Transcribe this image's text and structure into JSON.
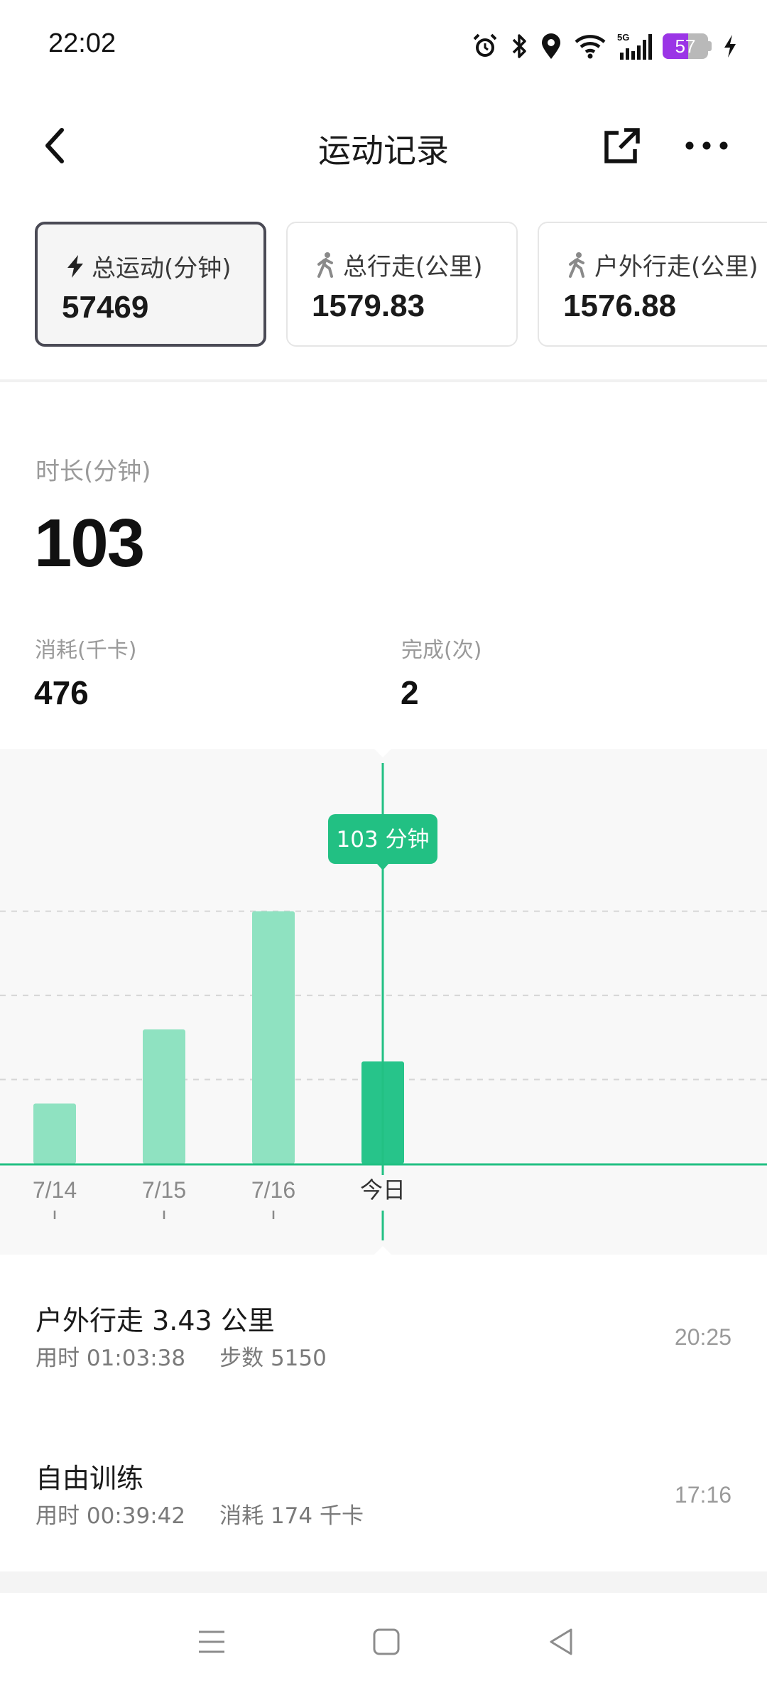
{
  "status_bar": {
    "time": "22:02",
    "network": "5G",
    "battery": "57",
    "battery_level": 0.57,
    "icons": [
      "alarm-icon",
      "bluetooth-icon",
      "location-icon",
      "wifi-icon",
      "signal-icon",
      "battery-icon",
      "charging-icon"
    ]
  },
  "header": {
    "title": "运动记录"
  },
  "cards": [
    {
      "label": "总运动(分钟)",
      "value": "57469",
      "icon": "lightning-icon",
      "active": true
    },
    {
      "label": "总行走(公里)",
      "value": "1579.83",
      "icon": "walking-icon",
      "active": false
    },
    {
      "label": "户外行走(公里)",
      "value": "1576.88",
      "icon": "walking-icon",
      "active": false
    }
  ],
  "summary": {
    "duration_label": "时长(分钟)",
    "duration_value": "103",
    "calories_label": "消耗(千卡)",
    "calories_value": "476",
    "completed_label": "完成(次)",
    "completed_value": "2"
  },
  "chart_data": {
    "type": "bar",
    "categories": [
      "7/14",
      "7/15",
      "7/16",
      "今日"
    ],
    "values": [
      30,
      67,
      126,
      51
    ],
    "highlighted_index": 3,
    "tooltip": "103 分钟",
    "gridlines": [
      42,
      84,
      126
    ],
    "colors": {
      "bar": "#8fe2c1",
      "bar_selected": "#27c48a",
      "accent": "#22c083"
    }
  },
  "records": [
    {
      "title": "户外行走 3.43 公里",
      "meta1": "用时 01:03:38",
      "meta2": "步数 5150",
      "time": "20:25"
    },
    {
      "title": "自由训练",
      "meta1": "用时 00:39:42",
      "meta2": "消耗 174 千卡",
      "time": "17:16"
    }
  ],
  "nav": {
    "icons": [
      "menu-icon",
      "home-icon",
      "back-triangle-icon"
    ]
  }
}
